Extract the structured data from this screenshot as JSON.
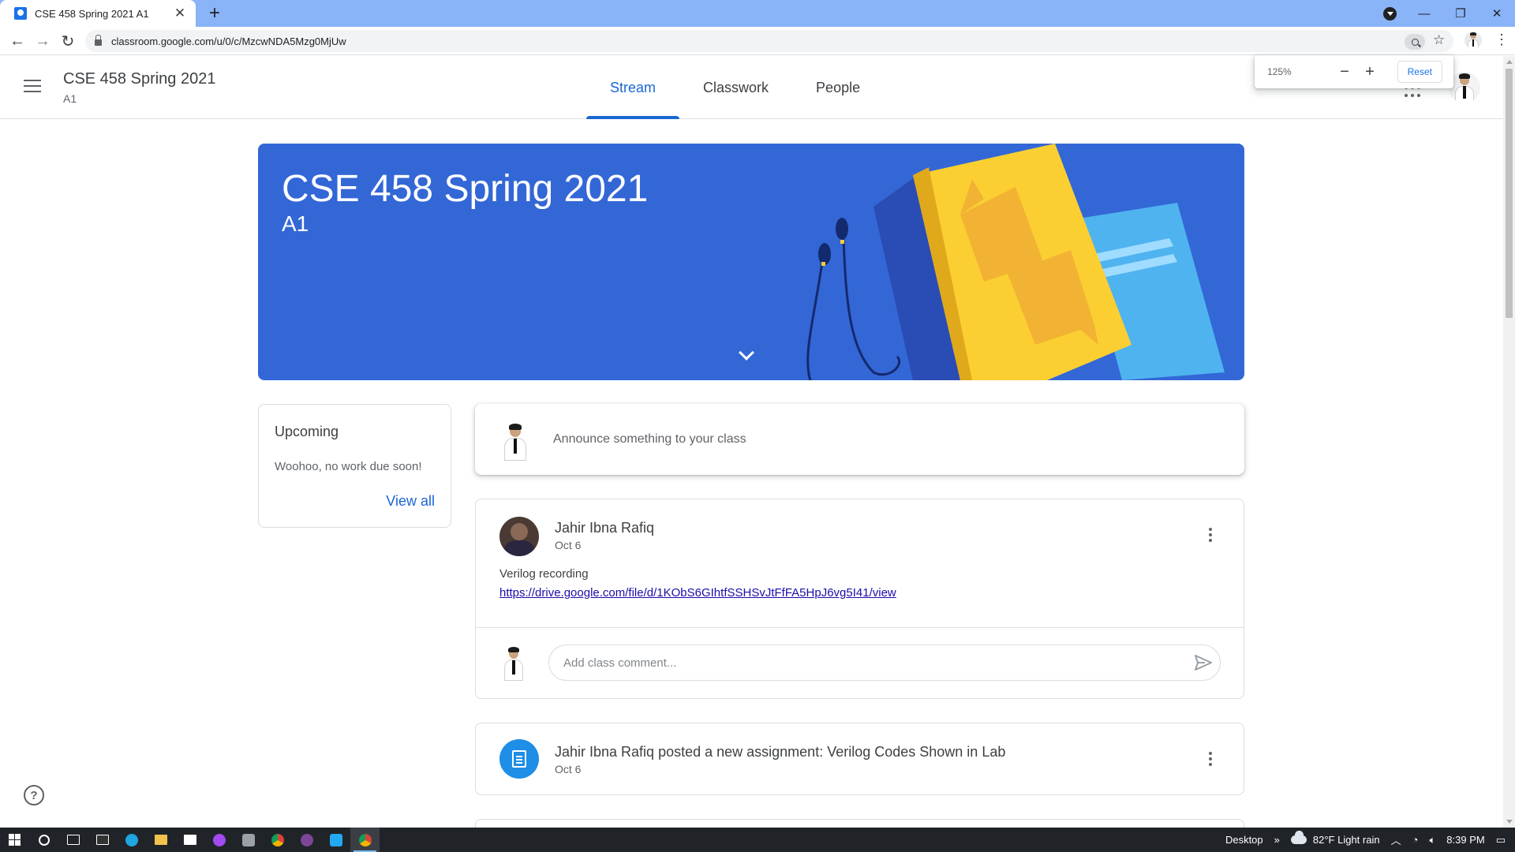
{
  "browser": {
    "tab_title": "CSE 458 Spring 2021 A1",
    "url": "classroom.google.com/u/0/c/MzcwNDA5Mzg0MjUw",
    "zoom_level": "125%",
    "zoom_reset_label": "Reset",
    "icons": [
      "back-arrow-icon",
      "forward-arrow-icon",
      "reload-icon",
      "lock-icon",
      "zoom-icon",
      "star-icon",
      "profile-avatar",
      "menu-kebab-icon"
    ]
  },
  "header": {
    "class_title": "CSE 458 Spring 2021",
    "section": "A1",
    "tabs": [
      {
        "label": "Stream",
        "active": true
      },
      {
        "label": "Classwork",
        "active": false
      },
      {
        "label": "People",
        "active": false
      }
    ]
  },
  "banner": {
    "title": "CSE 458 Spring 2021",
    "subtitle": "A1",
    "color": "#3367d6"
  },
  "upcoming": {
    "title": "Upcoming",
    "text": "Woohoo, no work due soon!",
    "link": "View all"
  },
  "announce": {
    "placeholder": "Announce something to your class"
  },
  "posts": [
    {
      "author": "Jahir Ibna Rafiq",
      "date": "Oct 6",
      "text": "Verilog recording",
      "link": "https://drive.google.com/file/d/1KObS6GIhtfSSHSvJtFfFA5HpJ6vg5I41/view",
      "comment_placeholder": "Add class comment..."
    }
  ],
  "assignment": {
    "title": "Jahir Ibna Rafiq posted a new assignment: Verilog Codes Shown in Lab",
    "date": "Oct 6"
  },
  "taskbar": {
    "desktop_label": "Desktop",
    "weather": "82°F  Light rain",
    "time": "8:39 PM"
  },
  "colors": {
    "accent": "#1967d2",
    "link": "#1a0dab",
    "tabstrip": "#8ab4f8"
  }
}
